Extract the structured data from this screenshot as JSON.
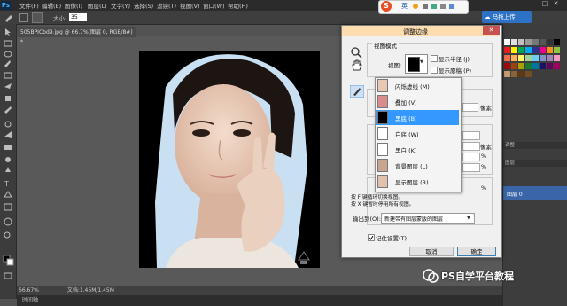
{
  "app": {
    "logo": "Ps",
    "menu": [
      "文件(F)",
      "编辑(E)",
      "图像(I)",
      "图层(L)",
      "文字(Y)",
      "选择(S)",
      "滤镜(T)",
      "视图(V)",
      "窗口(W)",
      "帮助(H)"
    ]
  },
  "options_bar": {
    "size_label": "大小:",
    "size_value": "35"
  },
  "ime": {
    "logo": "S",
    "mode": "英"
  },
  "cloud_button": "马拖上传",
  "document": {
    "tab": "505BPICbd9.jpg @ 66.7%(图层 0, RGB/8#) *",
    "zoom": "66.67%",
    "doc_info": "文档:1.45M/1.45M",
    "timeline": "时间轴"
  },
  "panels": {
    "adjust_tab": "调整",
    "layers_tab": "图层",
    "layer_name": "图层 0"
  },
  "dialog": {
    "title": "调整边缘",
    "view_mode_group": "视图模式",
    "view_label": "视图:",
    "show_radius": "显示半径 (J)",
    "show_original": "显示原稿 (P)",
    "px_unit_1": "像素",
    "px_unit_2": "像素",
    "pct_1": "%",
    "pct_2": "%",
    "pct_3": "%",
    "output_to_label": "输出到(O):",
    "output_to_value": "新建带有图层蒙版的图层",
    "remember": "记住设置(T)",
    "cancel": "取消",
    "ok": "确定"
  },
  "view_menu": {
    "items": [
      {
        "label": "闪烁虚线 (M)",
        "thumb": "photo"
      },
      {
        "label": "叠加 (V)",
        "thumb": "photo"
      },
      {
        "label": "黑底 (B)",
        "thumb": "black",
        "selected": true
      },
      {
        "label": "白底 (W)",
        "thumb": "white"
      },
      {
        "label": "黑白 (K)",
        "thumb": "bw"
      },
      {
        "label": "背景图层 (L)",
        "thumb": "photo"
      },
      {
        "label": "显示图层 (R)",
        "thumb": "photo"
      }
    ],
    "hint_1": "按 F 键循环切换视图。",
    "hint_2": "按 X 键暂时停用所有视图。"
  },
  "watermark": "PS自学平台教程",
  "colors": {
    "selection": "#3399ff",
    "dialog_title": "#fddcb0",
    "close": "#c75050"
  }
}
